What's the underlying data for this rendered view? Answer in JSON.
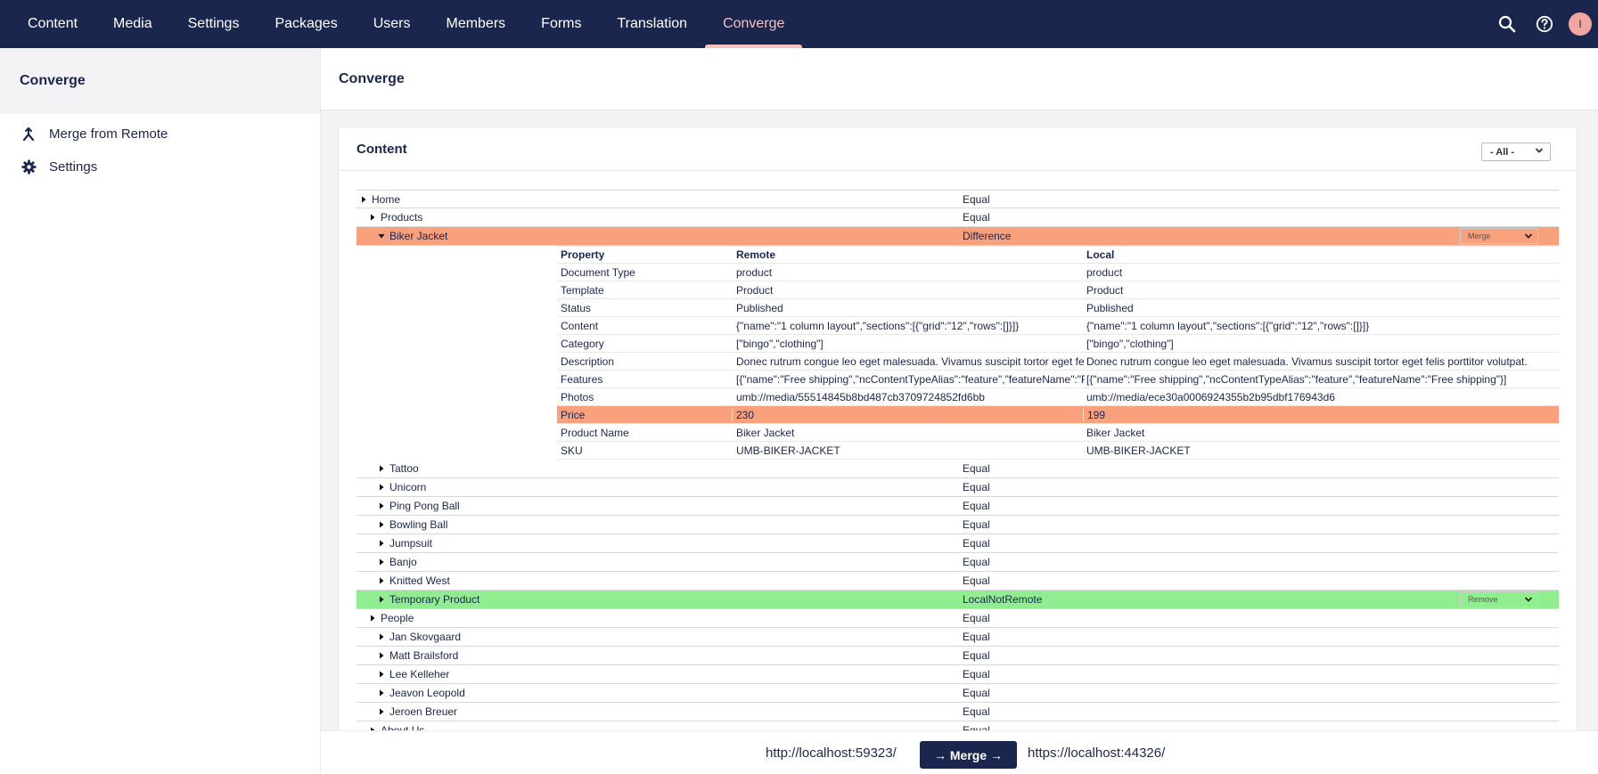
{
  "nav": {
    "items": [
      "Content",
      "Media",
      "Settings",
      "Packages",
      "Users",
      "Members",
      "Forms",
      "Translation",
      "Converge"
    ],
    "active": "Converge",
    "avatar_initial": "I"
  },
  "sidebar": {
    "title": "Converge",
    "items": [
      {
        "label": "Merge from Remote",
        "icon": "merge-icon"
      },
      {
        "label": "Settings",
        "icon": "gear-icon"
      }
    ]
  },
  "main": {
    "header": "Converge",
    "box_title": "Content",
    "filter_value": "- All -"
  },
  "tree": {
    "rows": [
      {
        "name": "Home",
        "status": "Equal",
        "depth": 0,
        "expanded": false
      },
      {
        "name": "Products",
        "status": "Equal",
        "depth": 1,
        "expanded": false
      },
      {
        "name": "Biker Jacket",
        "status": "Difference",
        "depth": 2,
        "expanded": true,
        "highlight": "diff",
        "action": "Merge"
      },
      {
        "name": "Tattoo",
        "status": "Equal",
        "depth": 2,
        "expanded": false
      },
      {
        "name": "Unicorn",
        "status": "Equal",
        "depth": 2,
        "expanded": false
      },
      {
        "name": "Ping Pong Ball",
        "status": "Equal",
        "depth": 2,
        "expanded": false
      },
      {
        "name": "Bowling Ball",
        "status": "Equal",
        "depth": 2,
        "expanded": false
      },
      {
        "name": "Jumpsuit",
        "status": "Equal",
        "depth": 2,
        "expanded": false
      },
      {
        "name": "Banjo",
        "status": "Equal",
        "depth": 2,
        "expanded": false
      },
      {
        "name": "Knitted West",
        "status": "Equal",
        "depth": 2,
        "expanded": false
      },
      {
        "name": "Temporary Product",
        "status": "LocalNotRemote",
        "depth": 2,
        "expanded": false,
        "highlight": "add",
        "action": "Remove"
      },
      {
        "name": "People",
        "status": "Equal",
        "depth": 1,
        "expanded": false
      },
      {
        "name": "Jan Skovgaard",
        "status": "Equal",
        "depth": 2,
        "expanded": false
      },
      {
        "name": "Matt Brailsford",
        "status": "Equal",
        "depth": 2,
        "expanded": false
      },
      {
        "name": "Lee Kelleher",
        "status": "Equal",
        "depth": 2,
        "expanded": false
      },
      {
        "name": "Jeavon Leopold",
        "status": "Equal",
        "depth": 2,
        "expanded": false
      },
      {
        "name": "Jeroen Breuer",
        "status": "Equal",
        "depth": 2,
        "expanded": false
      },
      {
        "name": "About Us",
        "status": "Equal",
        "depth": 1,
        "expanded": false
      }
    ]
  },
  "properties": {
    "headers": [
      "Property",
      "Remote",
      "Local"
    ],
    "rows": [
      {
        "property": "Document Type",
        "remote": "product",
        "local": "product"
      },
      {
        "property": "Template",
        "remote": "Product",
        "local": "Product"
      },
      {
        "property": "Status",
        "remote": "Published",
        "local": "Published"
      },
      {
        "property": "Content",
        "remote": "{\"name\":\"1 column layout\",\"sections\":[{\"grid\":\"12\",\"rows\":[]}]}",
        "local": "{\"name\":\"1 column layout\",\"sections\":[{\"grid\":\"12\",\"rows\":[]}]}"
      },
      {
        "property": "Category",
        "remote": "[\"bingo\",\"clothing\"]",
        "local": "[\"bingo\",\"clothing\"]"
      },
      {
        "property": "Description",
        "remote": "Donec rutrum congue leo eget malesuada. Vivamus suscipit tortor eget felis porttitor volutpat.",
        "local": "Donec rutrum congue leo eget malesuada. Vivamus suscipit tortor eget felis porttitor volutpat."
      },
      {
        "property": "Features",
        "remote": "[{\"name\":\"Free shipping\",\"ncContentTypeAlias\":\"feature\",\"featureName\":\"Free shipping\"}]",
        "local": "[{\"name\":\"Free shipping\",\"ncContentTypeAlias\":\"feature\",\"featureName\":\"Free shipping\"}]"
      },
      {
        "property": "Photos",
        "remote": "umb://media/55514845b8bd487cb3709724852fd6bb",
        "local": "umb://media/ece30a0006924355b2b95dbf176943d6"
      },
      {
        "property": "Price",
        "remote": "230",
        "local": "199",
        "diff": true
      },
      {
        "property": "Product Name",
        "remote": "Biker Jacket",
        "local": "Biker Jacket"
      },
      {
        "property": "SKU",
        "remote": "UMB-BIKER-JACKET",
        "local": "UMB-BIKER-JACKET"
      }
    ]
  },
  "footer": {
    "remote_url": "http://localhost:59323/",
    "merge_label": "→ Merge →",
    "local_url": "https://localhost:44326/"
  },
  "colors": {
    "nav_bg": "#1b264f",
    "accent": "#f5c1bc",
    "difference": "#f9a07c",
    "local_not_remote": "#90ee90"
  }
}
